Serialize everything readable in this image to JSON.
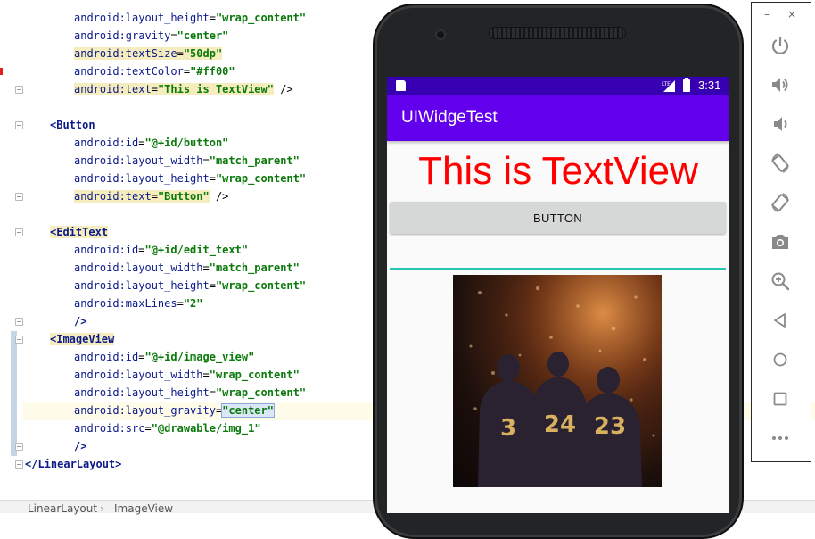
{
  "editor": {
    "lines": [
      {
        "indent": 2,
        "attr": "android:layout_height",
        "value": "wrap_content"
      },
      {
        "indent": 2,
        "attr": "android:gravity",
        "value": "center"
      },
      {
        "indent": 2,
        "attr": "android:textSize",
        "value": "50dp"
      },
      {
        "indent": 2,
        "attr": "android:textColor",
        "value": "#ff00"
      },
      {
        "indent": 2,
        "attr": "android:text",
        "value": "This is TextView",
        "close": " />"
      },
      {
        "indent": 1,
        "tag": "<Button"
      },
      {
        "indent": 2,
        "attr": "android:id",
        "value": "@+id/button"
      },
      {
        "indent": 2,
        "attr": "android:layout_width",
        "value": "match_parent"
      },
      {
        "indent": 2,
        "attr": "android:layout_height",
        "value": "wrap_content"
      },
      {
        "indent": 2,
        "attr": "android:text",
        "value": "Button",
        "close": " />"
      },
      {
        "indent": 1,
        "tag": "<EditText"
      },
      {
        "indent": 2,
        "attr": "android:id",
        "value": "@+id/edit_text"
      },
      {
        "indent": 2,
        "attr": "android:layout_width",
        "value": "match_parent"
      },
      {
        "indent": 2,
        "attr": "android:layout_height",
        "value": "wrap_content"
      },
      {
        "indent": 2,
        "attr": "android:maxLines",
        "value": "2"
      },
      {
        "indent": 2,
        "tag": "/>"
      },
      {
        "indent": 1,
        "tag": "<ImageView"
      },
      {
        "indent": 2,
        "attr": "android:id",
        "value": "@+id/image_view"
      },
      {
        "indent": 2,
        "attr": "android:layout_width",
        "value": "wrap_content"
      },
      {
        "indent": 2,
        "attr": "android:layout_height",
        "value": "wrap_content"
      },
      {
        "indent": 2,
        "attr": "android:layout_gravity",
        "value": "center"
      },
      {
        "indent": 2,
        "attr": "android:src",
        "value": "@drawable/img_1"
      },
      {
        "indent": 2,
        "tag": "/>"
      },
      {
        "indent": 0,
        "tag": "</LinearLayout>"
      }
    ]
  },
  "breadcrumb": {
    "items": [
      "LinearLayout",
      "ImageView"
    ],
    "separator": "›"
  },
  "device": {
    "status_time": "3:31",
    "status_network": "LTE",
    "app_title": "UIWidgeTest",
    "textview_text": "This is TextView",
    "button_label": "BUTTON",
    "edittext_value": "",
    "image_jersey_numbers": [
      "3",
      "24",
      "23"
    ]
  },
  "emulator_panel": {
    "window_controls": [
      "–",
      "×"
    ],
    "tools": [
      {
        "name": "power-icon",
        "label": "Power"
      },
      {
        "name": "volume-up-icon",
        "label": "Volume up"
      },
      {
        "name": "volume-down-icon",
        "label": "Volume down"
      },
      {
        "name": "rotate-left-icon",
        "label": "Rotate left"
      },
      {
        "name": "rotate-right-icon",
        "label": "Rotate right"
      },
      {
        "name": "camera-icon",
        "label": "Take screenshot"
      },
      {
        "name": "zoom-icon",
        "label": "Zoom"
      },
      {
        "name": "back-icon",
        "label": "Back"
      },
      {
        "name": "home-icon",
        "label": "Home"
      },
      {
        "name": "overview-icon",
        "label": "Overview"
      },
      {
        "name": "more-icon",
        "label": "More"
      }
    ]
  },
  "colors": {
    "status_bar": "#3700b3",
    "app_bar": "#6200ee",
    "textview": "#ff0000",
    "edittext_underline": "#26c6b0",
    "code_attr": "#0c1a8a",
    "code_value": "#0a7a0a"
  }
}
